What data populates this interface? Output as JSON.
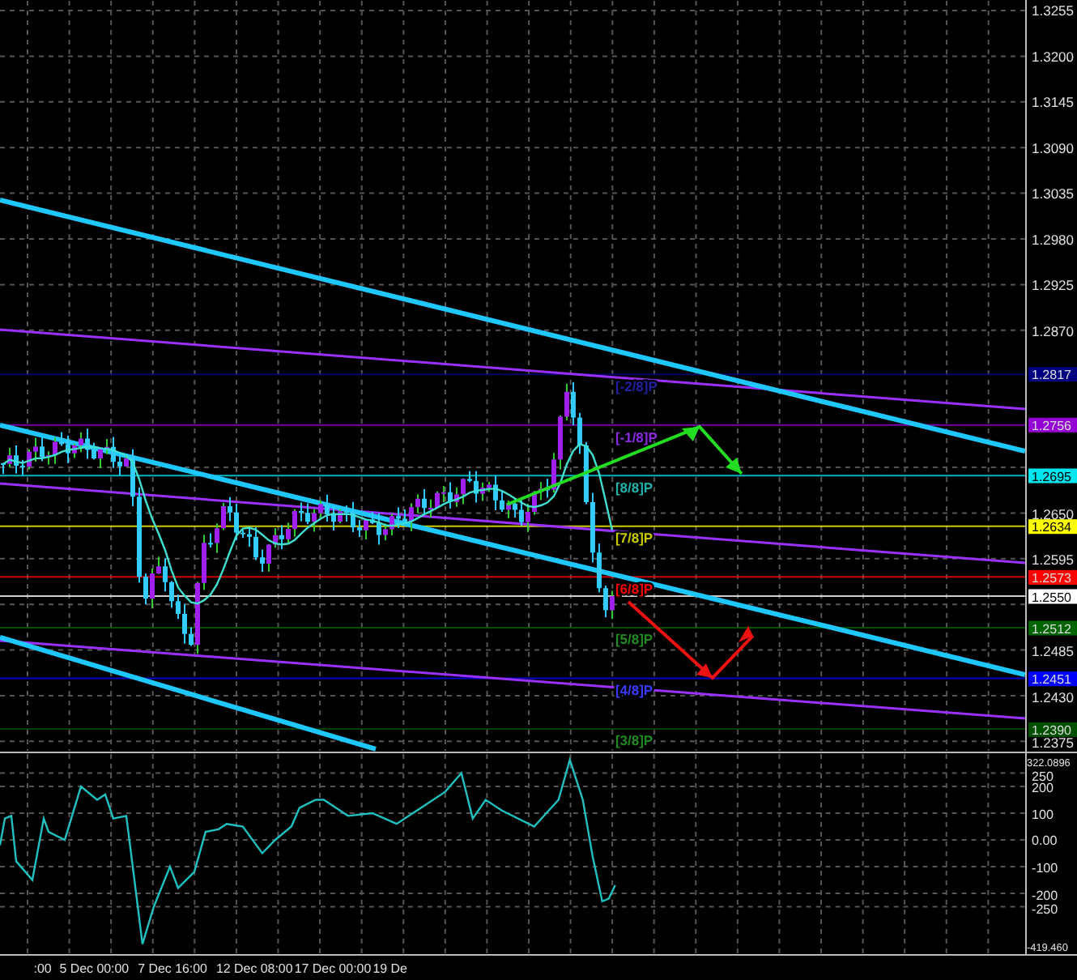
{
  "price_chart": {
    "price_axis": [
      "1.3255",
      "1.3200",
      "1.3145",
      "1.3090",
      "1.3035",
      "1.2980",
      "1.2925",
      "1.2870",
      "1.2650",
      "1.2595",
      "1.2485",
      "1.2430",
      "1.2375"
    ],
    "level_badges": [
      {
        "text": "1.2817",
        "color": "#000080"
      },
      {
        "text": "1.2756",
        "color": "#9400d3"
      },
      {
        "text": "1.2695",
        "color": "#00e5ee"
      },
      {
        "text": "1.2634",
        "color": "#ffff00"
      },
      {
        "text": "1.2573",
        "color": "#ff0000"
      },
      {
        "text": "1.2550",
        "color": "#ffffff"
      },
      {
        "text": "1.2512",
        "color": "#006400"
      },
      {
        "text": "1.2451",
        "color": "#0000ff"
      },
      {
        "text": "1.2390",
        "color": "#005000"
      }
    ],
    "murrey_labels": [
      {
        "text": "[-2/8]P",
        "color": "#2020a0"
      },
      {
        "text": "[-1/8]P",
        "color": "#8a2be2"
      },
      {
        "text": "[8/8]P",
        "color": "#20b2aa"
      },
      {
        "text": "[7/8]P",
        "color": "#c8c800"
      },
      {
        "text": "[6/8]P",
        "color": "#ff0000"
      },
      {
        "text": "[5/8]P",
        "color": "#1f8a1f"
      },
      {
        "text": "[4/8]P",
        "color": "#3a3aff"
      },
      {
        "text": "[3/8]P",
        "color": "#1f8a1f"
      }
    ]
  },
  "indicator": {
    "axis": [
      "322.0896",
      "250",
      "200",
      "100",
      "0.00",
      "-100",
      "-200",
      "-250",
      "-419.460"
    ]
  },
  "time_axis": [
    ":00",
    "5 Dec 00:00",
    "7 Dec 16:00",
    "12 Dec 08:00",
    "17 Dec 00:00",
    "19 De"
  ]
}
